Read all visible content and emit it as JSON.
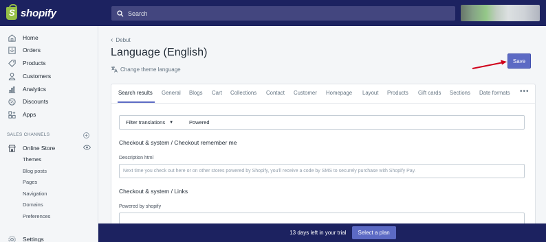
{
  "app": {
    "logo_text": "shopify",
    "logo_glyph": "S"
  },
  "search": {
    "placeholder": "Search"
  },
  "sidebar": {
    "items": [
      {
        "label": "Home",
        "icon": "home-icon"
      },
      {
        "label": "Orders",
        "icon": "orders-icon"
      },
      {
        "label": "Products",
        "icon": "tag-icon"
      },
      {
        "label": "Customers",
        "icon": "person-icon"
      },
      {
        "label": "Analytics",
        "icon": "bar-chart-icon"
      },
      {
        "label": "Discounts",
        "icon": "discount-icon"
      },
      {
        "label": "Apps",
        "icon": "apps-icon"
      }
    ],
    "sales_channels_label": "SALES CHANNELS",
    "online_store": {
      "label": "Online Store",
      "icon": "store-icon"
    },
    "sub_items": [
      "Themes",
      "Blog posts",
      "Pages",
      "Navigation",
      "Domains",
      "Preferences"
    ],
    "settings_label": "Settings"
  },
  "page": {
    "breadcrumb": "Debut",
    "title": "Language (English)",
    "change_language": "Change theme language",
    "save_label": "Save"
  },
  "tabs": [
    "Search results",
    "General",
    "Blogs",
    "Cart",
    "Collections",
    "Contact",
    "Customer",
    "Homepage",
    "Layout",
    "Products",
    "Gift cards",
    "Sections",
    "Date formats"
  ],
  "more_label": "•••",
  "filter": {
    "label": "Filter translations",
    "value": "Powered"
  },
  "sections": [
    {
      "title": "Checkout & system / Checkout remember me",
      "field_label": "Description html",
      "field_value": "Next time you check out here or on other stores powered by Shopify, you'll receive a code by SMS to securely purchase with Shopify Pay."
    },
    {
      "title": "Checkout & system / Links",
      "field_label": "Powered by shopify",
      "field_value": ""
    }
  ],
  "trial": {
    "text": "13 days left in your trial",
    "button": "Select a plan"
  },
  "colors": {
    "topbar": "#1c2260",
    "accent": "#5c6ac4",
    "arrow": "#d0021b"
  }
}
